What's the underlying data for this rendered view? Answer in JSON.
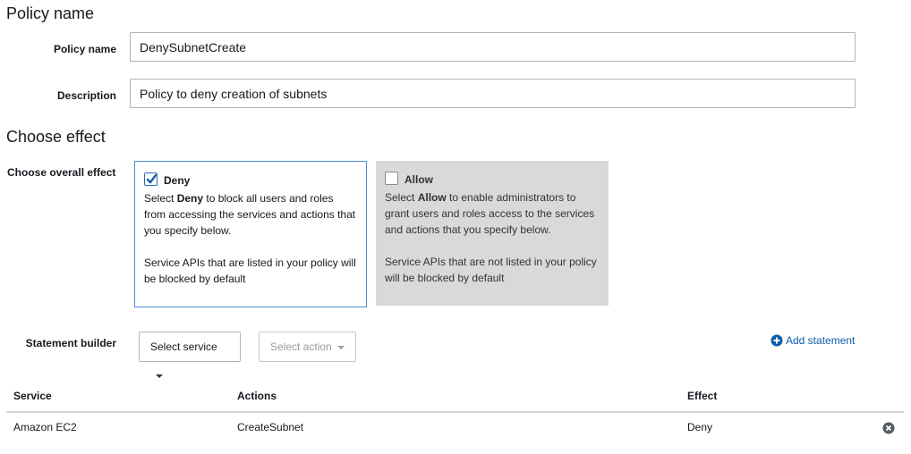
{
  "sections": {
    "policy_name_heading": "Policy name",
    "choose_effect_heading": "Choose effect"
  },
  "fields": {
    "policy_name_label": "Policy name",
    "policy_name_value": "DenySubnetCreate",
    "description_label": "Description",
    "description_value": "Policy to deny creation of subnets"
  },
  "effect": {
    "label": "Choose overall effect",
    "deny": {
      "title": "Deny",
      "checked": true,
      "desc_pre": "Select ",
      "desc_bold": "Deny",
      "desc_post": " to block all users and roles from accessing the services and actions that you specify below.",
      "note": "Service APIs that are listed in your policy will be blocked by default"
    },
    "allow": {
      "title": "Allow",
      "checked": false,
      "desc_pre": "Select ",
      "desc_bold": "Allow",
      "desc_post": " to enable administrators to grant users and roles access to the services and actions that you specify below.",
      "note": "Service APIs that are not listed in your policy will be blocked by default"
    }
  },
  "statement_builder": {
    "label": "Statement builder",
    "select_service": "Select service",
    "select_action": "Select action",
    "add_statement": "Add statement"
  },
  "table": {
    "headers": [
      "Service",
      "Actions",
      "Effect"
    ],
    "rows": [
      {
        "service": "Amazon EC2",
        "actions": "CreateSubnet",
        "effect": "Deny"
      }
    ]
  },
  "colors": {
    "accent": "#0a5ea8",
    "selected_border": "#4d8ad6",
    "unselected_bg": "#d9d9d9"
  }
}
